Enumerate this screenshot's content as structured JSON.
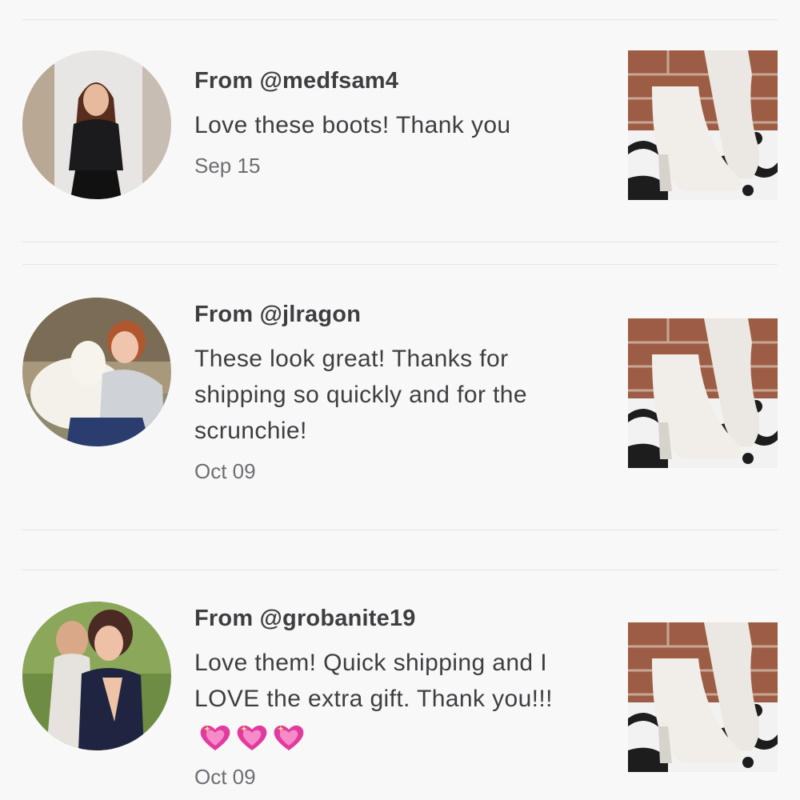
{
  "reviews": [
    {
      "from": "From @medfsam4",
      "comment": "Love these boots! Thank you",
      "date": "Sep 15"
    },
    {
      "from": "From @jlragon",
      "comment": "These look great! Thanks for shipping so quickly and for the scrunchie!",
      "date": "Oct 09"
    },
    {
      "from": "From @grobanite19",
      "comment": "Love them! Quick shipping and I LOVE the extra gift. Thank you!!!",
      "date": "Oct 09",
      "emoji": [
        "sparkling-heart-icon",
        "sparkling-heart-icon",
        "sparkling-heart-icon"
      ]
    }
  ],
  "colors": {
    "background": "#f9f8f9",
    "text": "#3e3e40",
    "muted": "#6e6e72",
    "divider": "#e6e4e6",
    "heart": "#e23b9e"
  }
}
